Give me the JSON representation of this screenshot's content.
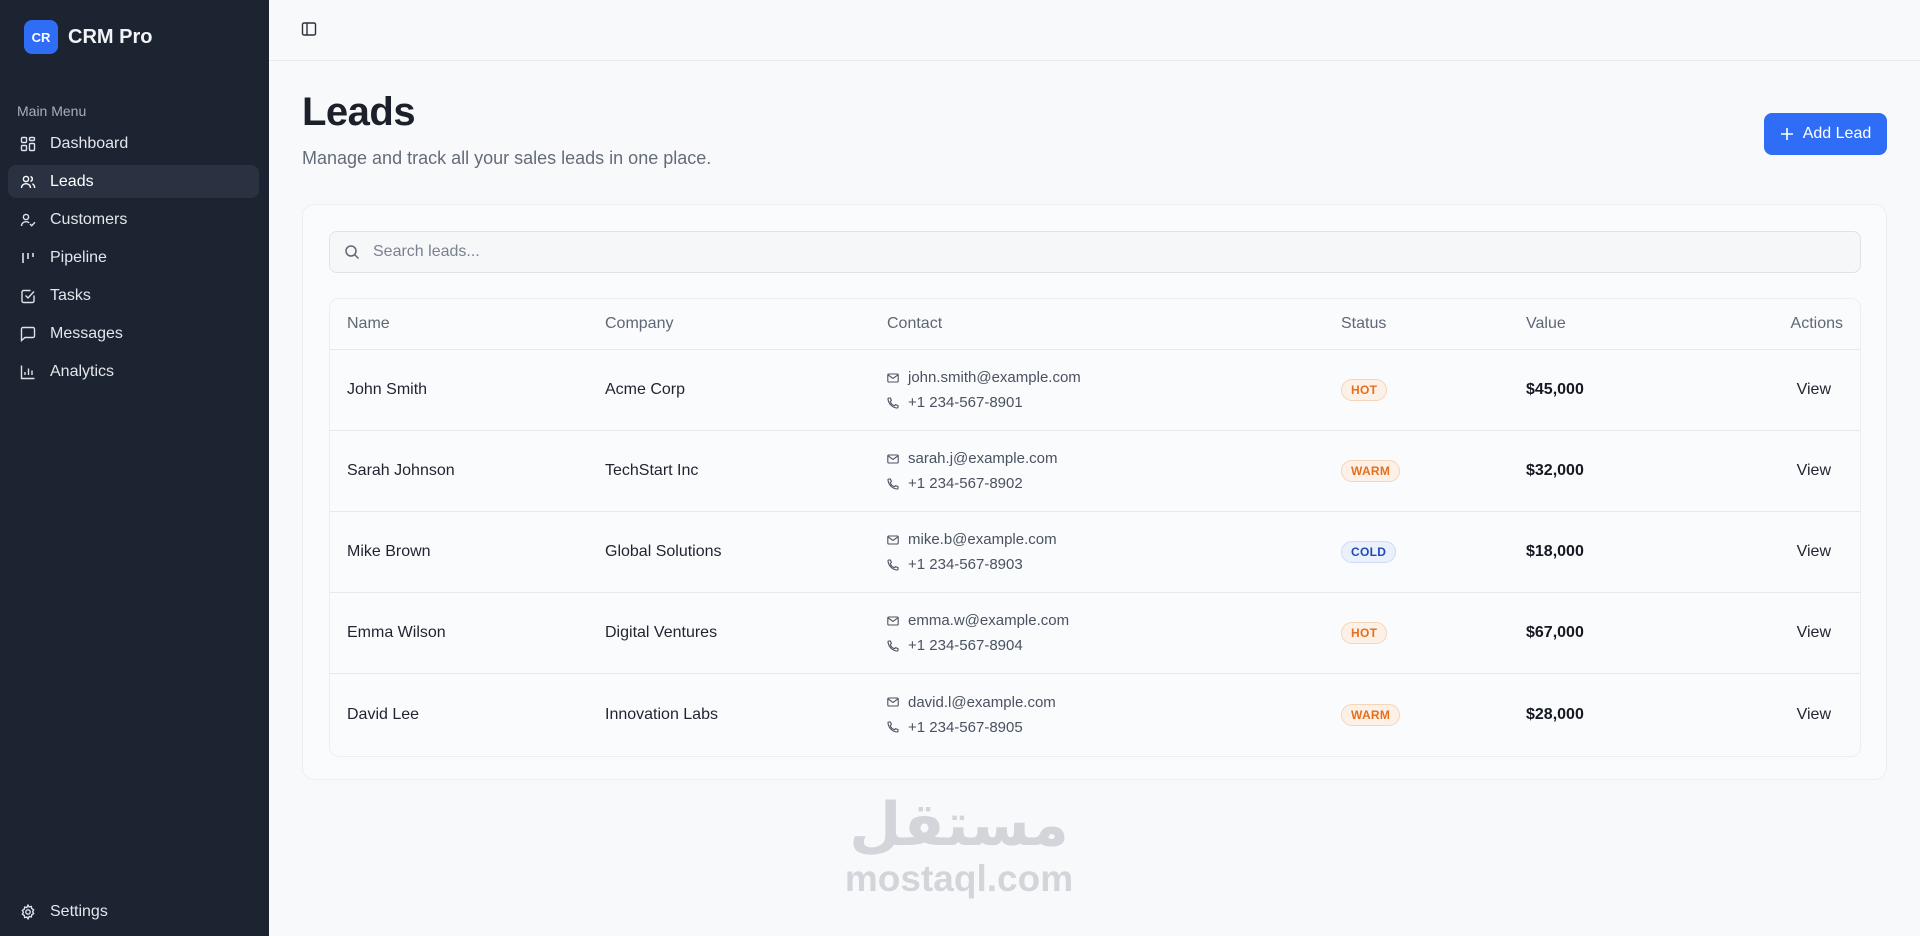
{
  "brand": {
    "logo_text": "CR",
    "name": "CRM Pro"
  },
  "sidebar": {
    "section_heading": "Main Menu",
    "items": [
      {
        "label": "Dashboard",
        "icon": "dashboard-icon"
      },
      {
        "label": "Leads",
        "icon": "users-icon",
        "active": true
      },
      {
        "label": "Customers",
        "icon": "user-check-icon"
      },
      {
        "label": "Pipeline",
        "icon": "pipeline-icon"
      },
      {
        "label": "Tasks",
        "icon": "check-square-icon"
      },
      {
        "label": "Messages",
        "icon": "message-icon"
      },
      {
        "label": "Analytics",
        "icon": "bar-chart-icon"
      }
    ],
    "settings_label": "Settings"
  },
  "header": {
    "title": "Leads",
    "subtitle": "Manage and track all your sales leads in one place.",
    "add_button_label": "Add Lead"
  },
  "search": {
    "placeholder": "Search leads..."
  },
  "table": {
    "columns": [
      "Name",
      "Company",
      "Contact",
      "Status",
      "Value",
      "Actions"
    ],
    "rows": [
      {
        "name": "John Smith",
        "company": "Acme Corp",
        "email": "john.smith@example.com",
        "phone": "+1 234-567-8901",
        "status": "HOT",
        "value": "$45,000",
        "action": "View"
      },
      {
        "name": "Sarah Johnson",
        "company": "TechStart Inc",
        "email": "sarah.j@example.com",
        "phone": "+1 234-567-8902",
        "status": "WARM",
        "value": "$32,000",
        "action": "View"
      },
      {
        "name": "Mike Brown",
        "company": "Global Solutions",
        "email": "mike.b@example.com",
        "phone": "+1 234-567-8903",
        "status": "COLD",
        "value": "$18,000",
        "action": "View"
      },
      {
        "name": "Emma Wilson",
        "company": "Digital Ventures",
        "email": "emma.w@example.com",
        "phone": "+1 234-567-8904",
        "status": "HOT",
        "value": "$67,000",
        "action": "View"
      },
      {
        "name": "David Lee",
        "company": "Innovation Labs",
        "email": "david.l@example.com",
        "phone": "+1 234-567-8905",
        "status": "WARM",
        "value": "$28,000",
        "action": "View"
      }
    ]
  },
  "watermark": {
    "arabic": "مستقل",
    "latin": "mostaql.com"
  },
  "colors": {
    "sidebar_bg": "#1c2331",
    "accent": "#2f6df6",
    "hot": "#e56f1e",
    "warm": "#e56f1e",
    "cold": "#2349b8"
  }
}
